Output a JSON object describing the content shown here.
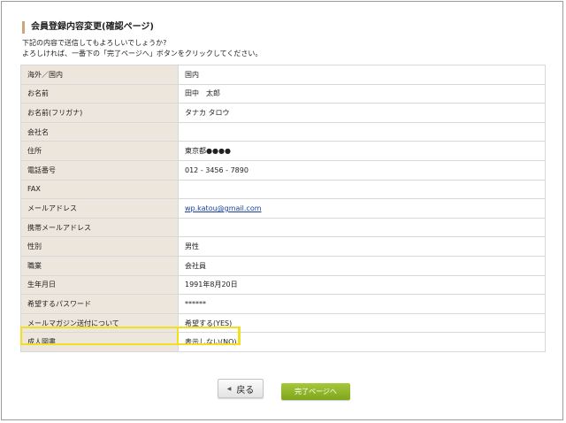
{
  "page": {
    "heading": "会員登録内容変更(確認ページ)",
    "intro_line1": "下記の内容で送信してもよろしいでしょうか?",
    "intro_line2": "よろしければ、一番下の「完了ページへ」ボタンをクリックしてください。"
  },
  "form": {
    "rows": [
      {
        "label": "海外／国内",
        "value": "国内"
      },
      {
        "label": "お名前",
        "value": "田中　太郎"
      },
      {
        "label": "お名前(フリガナ)",
        "value": "タナカ タロウ"
      },
      {
        "label": "会社名",
        "value": ""
      },
      {
        "label": "住所",
        "value": "東京都●●●●"
      },
      {
        "label": "電話番号",
        "value": "012 - 3456 - 7890"
      },
      {
        "label": "FAX",
        "value": ""
      },
      {
        "label": "メールアドレス",
        "value": "wp.katou@gmail.com"
      },
      {
        "label": "携帯メールアドレス",
        "value": ""
      },
      {
        "label": "性別",
        "value": "男性"
      },
      {
        "label": "職業",
        "value": "会社員"
      },
      {
        "label": "生年月日",
        "value": "1991年8月20日"
      },
      {
        "label": "希望するパスワード",
        "value": "******"
      },
      {
        "label": "メールマガジン送付について",
        "value": "希望する(YES)"
      },
      {
        "label": "成人図書",
        "value": "表示しない(NO)"
      }
    ]
  },
  "buttons": {
    "back_label": "戻る",
    "back_icon": "triangle-left-icon",
    "complete_label": "完了ページへ"
  },
  "colors": {
    "label_bg": "#ece6dc",
    "heading_bar": "#c8a977",
    "highlight": "#f2e020",
    "complete_button": "#8db52a",
    "link": "#1a3fa0"
  }
}
